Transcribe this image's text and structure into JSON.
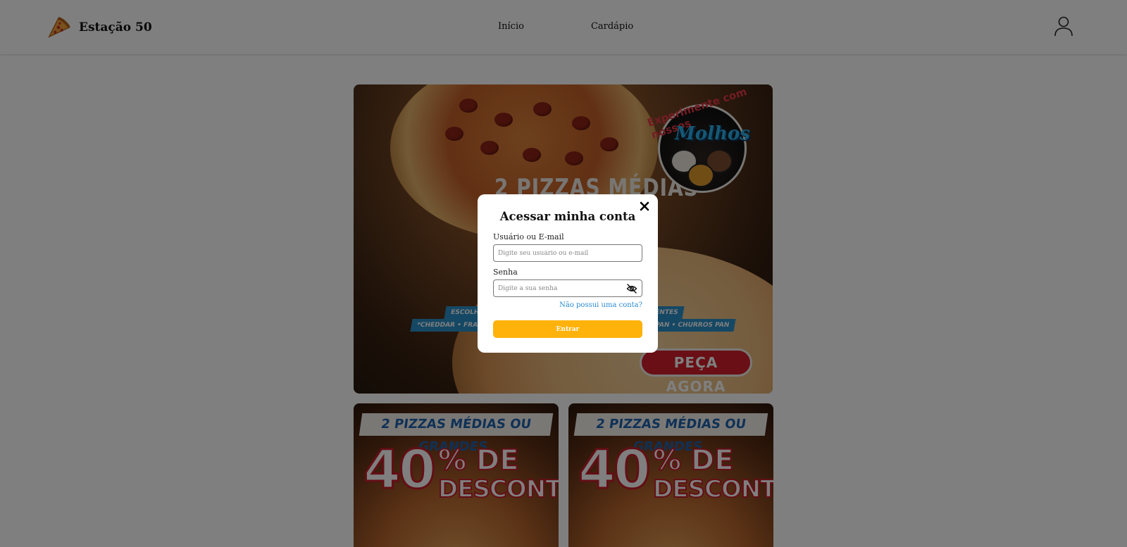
{
  "header": {
    "brand_name": "Estação 50",
    "logo_icon": "pizza-slice-icon",
    "nav": [
      {
        "label": "Início"
      },
      {
        "label": "Cardápio"
      }
    ],
    "user_icon": "user-icon"
  },
  "hero": {
    "headline": "2 PIZZAS MÉDIAS",
    "sauce_tagline": "Experimente com nossos",
    "sauce_title": "Molhos",
    "strip_left": "ESCOLHA C",
    "strip_left_2": "*CHEDDAR • FRANGO C/",
    "strip_right": "ENTES",
    "strip_right_2": "PAN • CHURROS PAN",
    "cta": "PEÇA AGORA"
  },
  "promos": [
    {
      "banner": "2 PIZZAS MÉDIAS OU GRANDES",
      "big": "40",
      "pct": "% DE",
      "desc": "DESCONTO"
    },
    {
      "banner": "2 PIZZAS MÉDIAS OU GRANDES",
      "big": "40",
      "pct": "% DE",
      "desc": "DESCONTO"
    }
  ],
  "modal": {
    "title": "Acessar minha conta",
    "user_label": "Usuário ou E-mail",
    "user_placeholder": "Digite seu usuário ou e-mail",
    "user_value": "",
    "pass_label": "Senha",
    "pass_placeholder": "Digite a sua senha",
    "pass_value": "",
    "signup_link": "Não possui uma conta?",
    "submit_label": "Entrar",
    "close_icon": "close-icon",
    "eye_icon": "eye-off-icon",
    "accent_color": "#ffb20a",
    "link_color": "#2a8bd4"
  }
}
